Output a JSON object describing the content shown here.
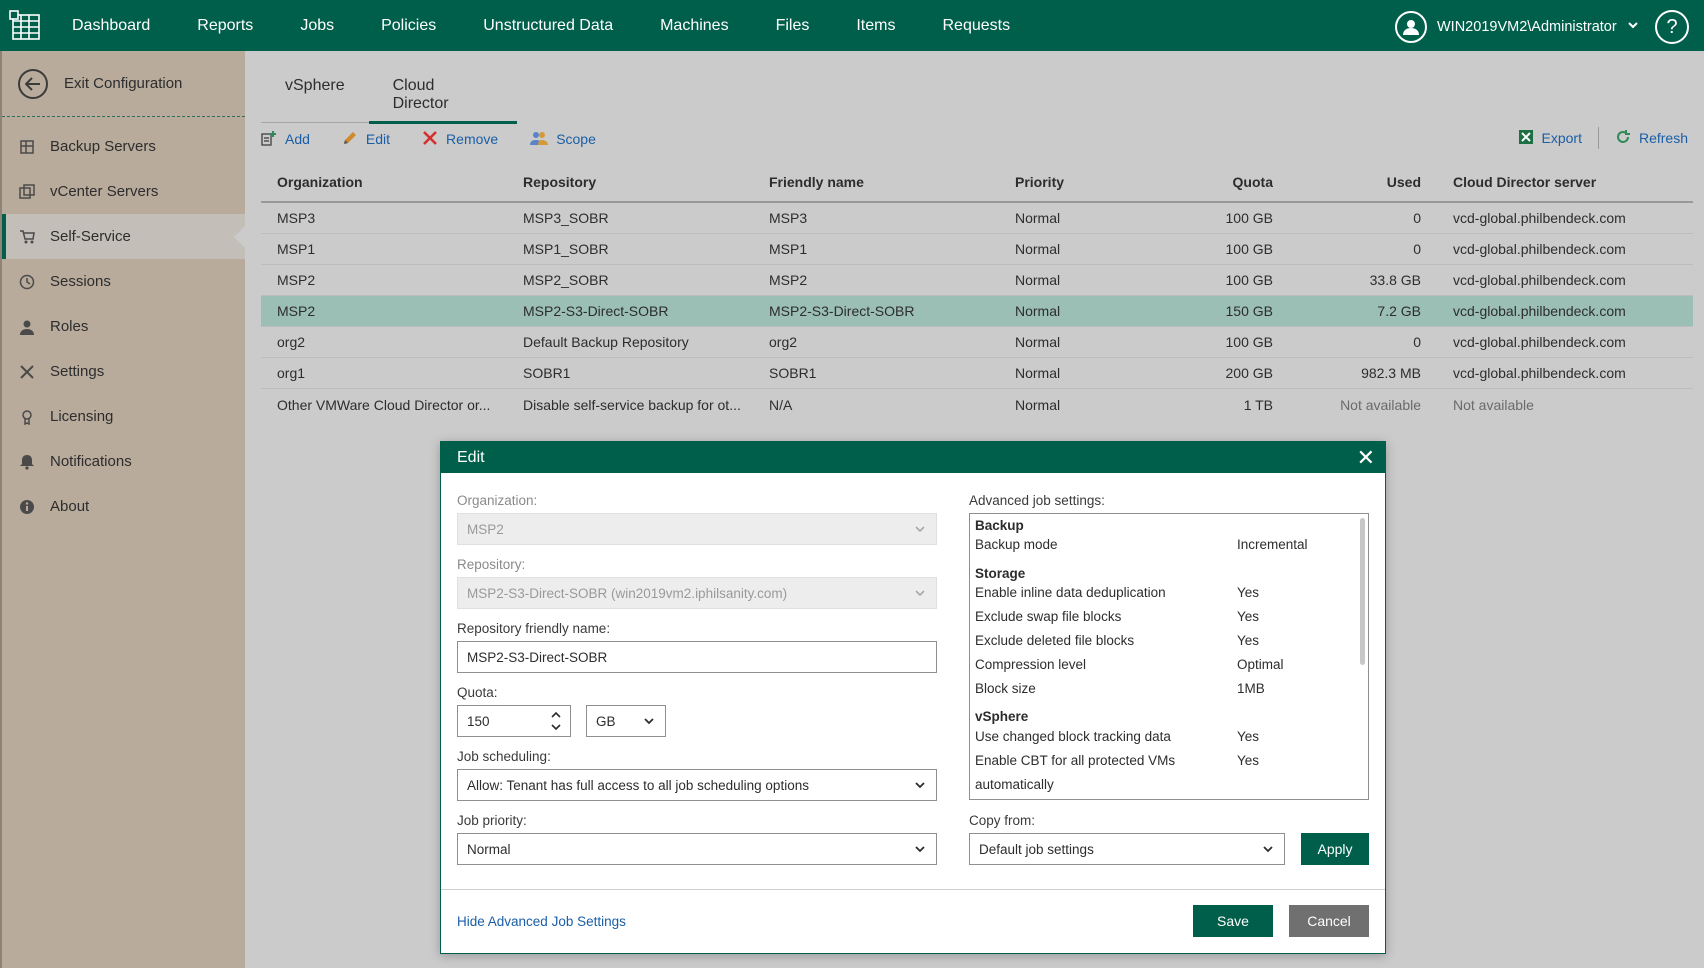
{
  "nav": [
    "Dashboard",
    "Reports",
    "Jobs",
    "Policies",
    "Unstructured Data",
    "Machines",
    "Files",
    "Items",
    "Requests"
  ],
  "user": "WIN2019VM2\\Administrator",
  "help": "?",
  "sidebar": {
    "exit_label": "Exit Configuration",
    "items": [
      {
        "label": "Backup Servers",
        "icon": "backup-servers-icon"
      },
      {
        "label": "vCenter Servers",
        "icon": "vcenter-servers-icon"
      },
      {
        "label": "Self-Service",
        "icon": "cart-icon"
      },
      {
        "label": "Sessions",
        "icon": "clock-icon"
      },
      {
        "label": "Roles",
        "icon": "person-icon"
      },
      {
        "label": "Settings",
        "icon": "tools-icon"
      },
      {
        "label": "Licensing",
        "icon": "license-icon"
      },
      {
        "label": "Notifications",
        "icon": "bell-icon"
      },
      {
        "label": "About",
        "icon": "info-icon"
      }
    ]
  },
  "tabs": [
    "vSphere",
    "Cloud Director"
  ],
  "toolbar": {
    "add": "Add",
    "edit": "Edit",
    "remove": "Remove",
    "scope": "Scope",
    "export": "Export",
    "refresh": "Refresh"
  },
  "table": {
    "columns": [
      "Organization",
      "Repository",
      "Friendly name",
      "Priority",
      "Quota",
      "Used",
      "Cloud Director server"
    ],
    "rows": [
      [
        "MSP3",
        "MSP3_SOBR",
        "MSP3",
        "Normal",
        "100 GB",
        "0",
        "vcd-global.philbendeck.com"
      ],
      [
        "MSP1",
        "MSP1_SOBR",
        "MSP1",
        "Normal",
        "100 GB",
        "0",
        "vcd-global.philbendeck.com"
      ],
      [
        "MSP2",
        "MSP2_SOBR",
        "MSP2",
        "Normal",
        "100 GB",
        "33.8 GB",
        "vcd-global.philbendeck.com"
      ],
      [
        "MSP2",
        "MSP2-S3-Direct-SOBR",
        "MSP2-S3-Direct-SOBR",
        "Normal",
        "150 GB",
        "7.2 GB",
        "vcd-global.philbendeck.com"
      ],
      [
        "org2",
        "Default Backup Repository",
        "org2",
        "Normal",
        "100 GB",
        "0",
        "vcd-global.philbendeck.com"
      ],
      [
        "org1",
        "SOBR1",
        "SOBR1",
        "Normal",
        "200 GB",
        "982.3 MB",
        "vcd-global.philbendeck.com"
      ],
      [
        "Other VMWare Cloud Director or...",
        "Disable self-service backup for ot...",
        "N/A",
        "Normal",
        "1 TB",
        "Not available",
        "Not available"
      ]
    ]
  },
  "dialog": {
    "title": "Edit",
    "close": "✕",
    "org_label": "Organization:",
    "org_value": "MSP2",
    "repo_label": "Repository:",
    "repo_value": "MSP2-S3-Direct-SOBR (win2019vm2.iphilsanity.com)",
    "friendly_label": "Repository friendly name:",
    "friendly_value": "MSP2-S3-Direct-SOBR",
    "quota_label": "Quota:",
    "quota_value": "150",
    "quota_unit": "GB",
    "sched_label": "Job scheduling:",
    "sched_value": "Allow: Tenant has full access to all job scheduling options",
    "priority_label": "Job priority:",
    "priority_value": "Normal",
    "adv_label": "Advanced job settings:",
    "adv": [
      {
        "k": "Backup",
        "v": "",
        "head": true
      },
      {
        "k": "Backup mode",
        "v": "Incremental"
      },
      {
        "k": "Storage",
        "v": "",
        "head": true
      },
      {
        "k": "Enable inline data deduplication",
        "v": "Yes"
      },
      {
        "k": "Exclude swap file blocks",
        "v": "Yes"
      },
      {
        "k": "Exclude deleted file blocks",
        "v": "Yes"
      },
      {
        "k": "Compression level",
        "v": "Optimal"
      },
      {
        "k": "Block size",
        "v": "1MB"
      },
      {
        "k": "vSphere",
        "v": "",
        "head": true
      },
      {
        "k": "Use changed block tracking data",
        "v": "Yes"
      },
      {
        "k": "Enable CBT for all protected VMs",
        "v": "Yes"
      },
      {
        "k": "automatically",
        "v": ""
      }
    ],
    "copy_label": "Copy from:",
    "copy_value": "Default job settings",
    "apply": "Apply",
    "hide_link": "Hide Advanced Job Settings",
    "save": "Save",
    "cancel": "Cancel"
  },
  "colors": {
    "brand": "#005f4b",
    "selected_row": "#9bbfb4",
    "link": "#1a5ea7"
  }
}
